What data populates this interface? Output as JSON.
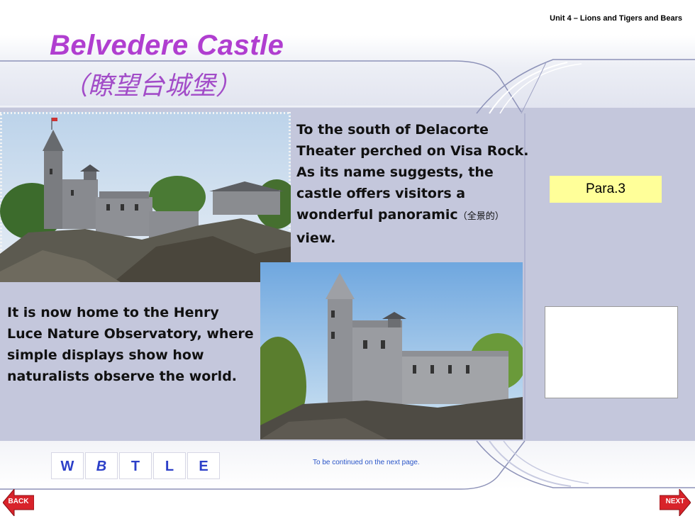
{
  "header": {
    "unit_label": "Unit 4 – Lions and Tigers and Bears"
  },
  "title": {
    "main": "Belvedere Castle",
    "chinese": "（瞭望台城堡）"
  },
  "paragraphs": {
    "p1_text": "To the south of Delacorte Theater perched on Visa Rock. As its name suggests, the castle offers visitors a wonderful panoramic",
    "p1_gloss": "（全景的）",
    "p1_tail": "view.",
    "p2_text": "It is now home to the Henry Luce Nature Observatory, where simple displays show how naturalists observe the world."
  },
  "para_tag": "Para.3",
  "nav": {
    "items": [
      "W",
      "B",
      "T",
      "L",
      "E"
    ]
  },
  "footer": {
    "continued": "To be continued on the next page."
  },
  "buttons": {
    "back": "BACK",
    "next": "NEXT"
  },
  "colors": {
    "title": "#b03ed0",
    "subtitle": "#a24cc8",
    "panel": "#c4c7dc",
    "para_tag_bg": "#ffff99",
    "nav_text": "#2c3fc8",
    "arrow_red": "#d8232a"
  },
  "icons": {
    "back": "back-arrow-icon",
    "next": "next-arrow-icon"
  }
}
